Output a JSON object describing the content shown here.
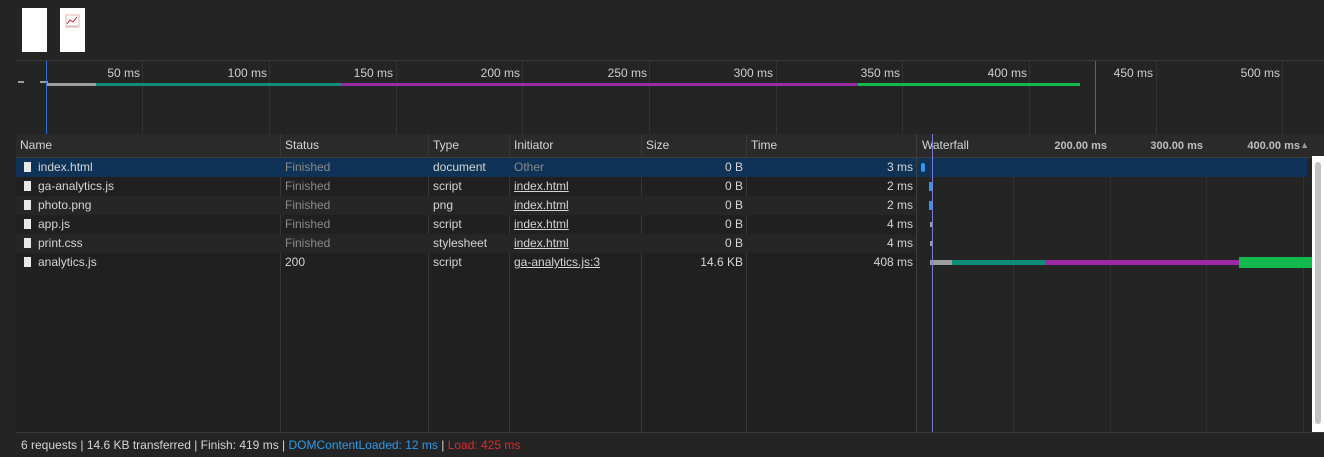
{
  "overview": {
    "ticks": [
      "50 ms",
      "100 ms",
      "150 ms",
      "200 ms",
      "250 ms",
      "300 ms",
      "350 ms",
      "400 ms",
      "450 ms",
      "500 ms"
    ]
  },
  "table": {
    "headers": {
      "name": "Name",
      "status": "Status",
      "type": "Type",
      "initiator": "Initiator",
      "size": "Size",
      "time": "Time"
    },
    "rows": [
      {
        "name": "index.html",
        "status": "Finished",
        "type": "document",
        "initiator": "Other",
        "size": "0 B",
        "time": "3 ms"
      },
      {
        "name": "ga-analytics.js",
        "status": "Finished",
        "type": "script",
        "initiator": "index.html",
        "size": "0 B",
        "time": "2 ms"
      },
      {
        "name": "photo.png",
        "status": "Finished",
        "type": "png",
        "initiator": "index.html",
        "size": "0 B",
        "time": "2 ms"
      },
      {
        "name": "app.js",
        "status": "Finished",
        "type": "script",
        "initiator": "index.html",
        "size": "0 B",
        "time": "4 ms"
      },
      {
        "name": "print.css",
        "status": "Finished",
        "type": "stylesheet",
        "initiator": "index.html",
        "size": "0 B",
        "time": "4 ms"
      },
      {
        "name": "analytics.js",
        "status": "200",
        "type": "script",
        "initiator": "ga-analytics.js:3",
        "size": "14.6 KB",
        "time": "408 ms"
      }
    ]
  },
  "waterfall": {
    "title": "Waterfall",
    "ticks": [
      "200.00 ms",
      "300.00 ms",
      "400.00 ms"
    ],
    "sort_icon": "sort-ascending-icon"
  },
  "statusbar": {
    "summary": "6 requests | 14.6 KB transferred | Finish: 419 ms | ",
    "dom_content_loaded": "DOMContentLoaded: 12 ms",
    "separator": " | ",
    "load": "Load: 425 ms"
  },
  "colors": {
    "queue": "#9e9e9e",
    "connect": "#0f8c7a",
    "waiting": "#9c2aa7",
    "download": "#13b94d",
    "dom_content_loaded": "#2e9ae6",
    "load": "#e0292d",
    "selected_row": "#0f3356"
  }
}
